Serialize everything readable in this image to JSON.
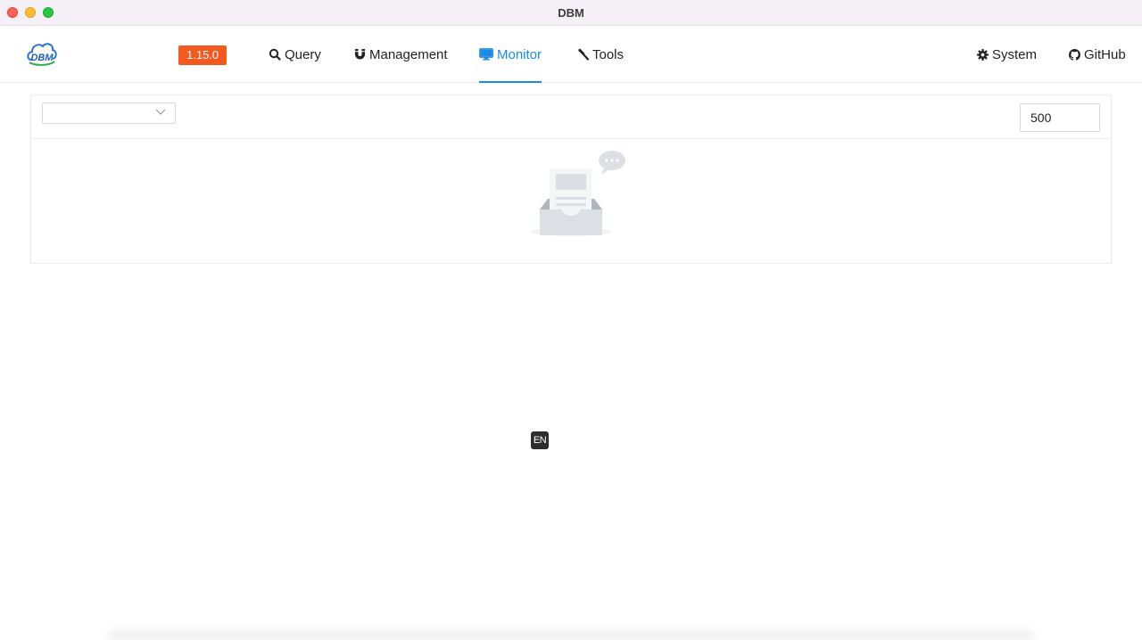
{
  "window": {
    "title": "DBM"
  },
  "header": {
    "version": "1.15.0",
    "nav_left": [
      {
        "label": "Query",
        "icon": "search-icon"
      },
      {
        "label": "Management",
        "icon": "magnet-icon"
      },
      {
        "label": "Monitor",
        "icon": "desktop-icon",
        "active": true
      },
      {
        "label": "Tools",
        "icon": "hammer-icon"
      }
    ],
    "nav_right": [
      {
        "label": "System",
        "icon": "gear-icon"
      },
      {
        "label": "GitHub",
        "icon": "github-icon"
      }
    ]
  },
  "monitor": {
    "select_value": "",
    "count_value": "500"
  },
  "ime": {
    "label": "EN"
  },
  "colors": {
    "accent": "#1d8ae8",
    "version_badge": "#f35a1f"
  }
}
